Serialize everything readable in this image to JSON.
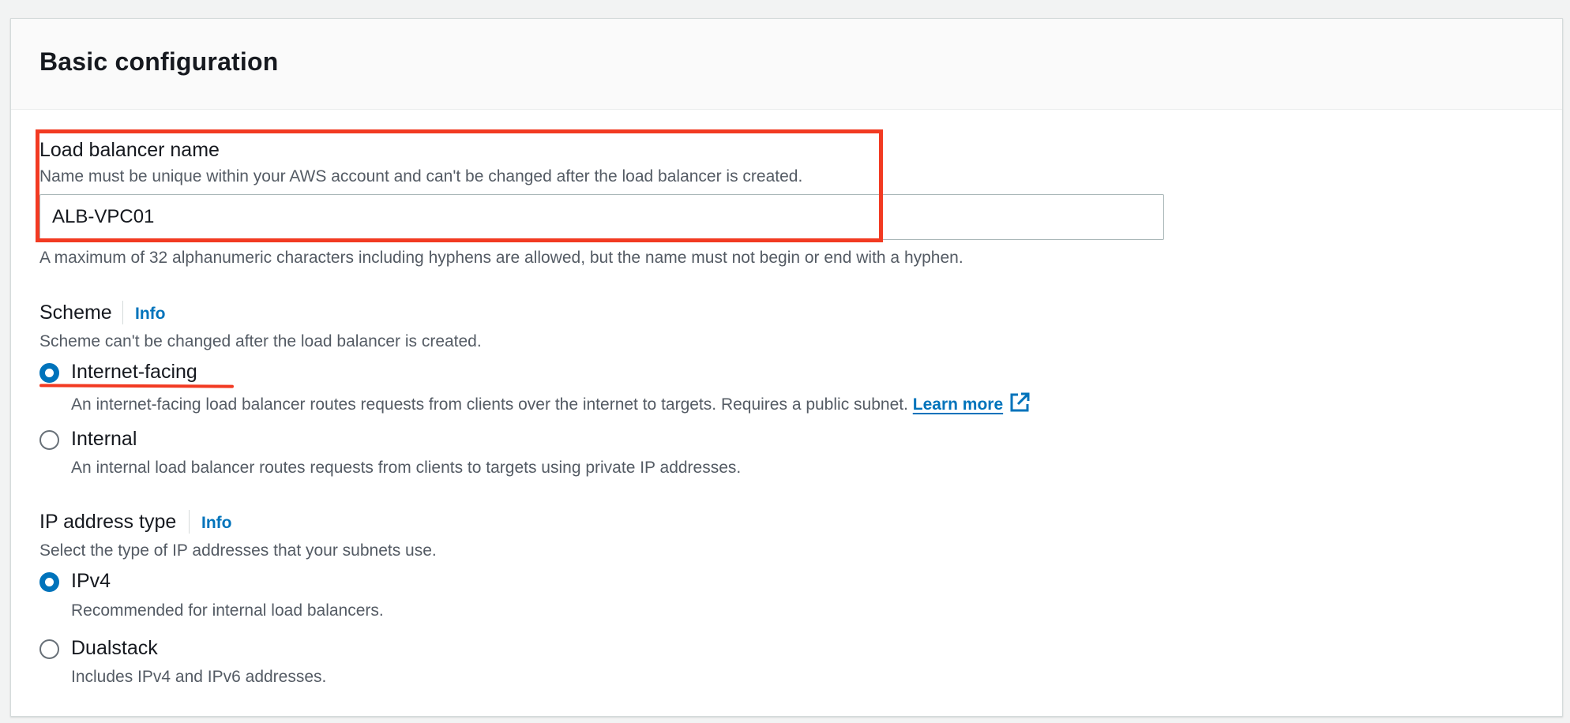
{
  "section": {
    "title": "Basic configuration"
  },
  "load_balancer_name": {
    "label": "Load balancer name",
    "description": "Name must be unique within your AWS account and can't be changed after the load balancer is created.",
    "value": "ALB-VPC01",
    "constraint": "A maximum of 32 alphanumeric characters including hyphens are allowed, but the name must not begin or end with a hyphen."
  },
  "scheme": {
    "label": "Scheme",
    "info": "Info",
    "description": "Scheme can't be changed after the load balancer is created.",
    "options": [
      {
        "label": "Internet-facing",
        "description": "An internet-facing load balancer routes requests from clients over the internet to targets. Requires a public subnet.",
        "link": "Learn more",
        "link_icon": "external-link-icon",
        "selected": true
      },
      {
        "label": "Internal",
        "description": "An internal load balancer routes requests from clients to targets using private IP addresses.",
        "selected": false
      }
    ]
  },
  "ip_address_type": {
    "label": "IP address type",
    "info": "Info",
    "description": "Select the type of IP addresses that your subnets use.",
    "options": [
      {
        "label": "IPv4",
        "description": "Recommended for internal load balancers.",
        "selected": true
      },
      {
        "label": "Dualstack",
        "description": "Includes IPv4 and IPv6 addresses.",
        "selected": false
      }
    ]
  },
  "colors": {
    "accent": "#0073bb",
    "highlight": "#f23a22",
    "text": "#16191f",
    "secondary_text": "#545b64"
  }
}
